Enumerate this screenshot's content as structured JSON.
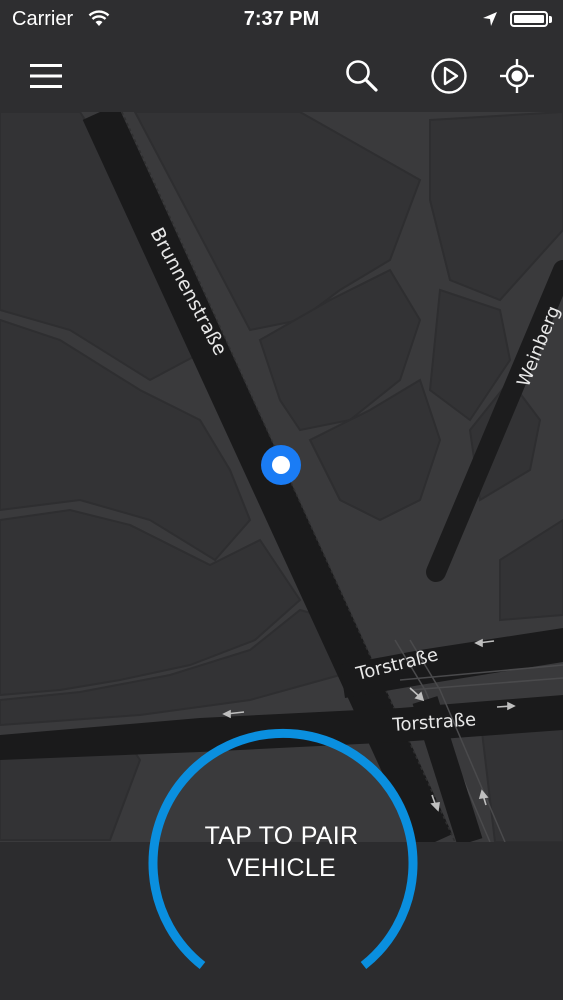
{
  "status_bar": {
    "carrier": "Carrier",
    "time": "7:37 PM"
  },
  "nav": {
    "icons": [
      "menu-icon",
      "search-icon",
      "play-icon",
      "crosshair-icon"
    ]
  },
  "map": {
    "street_labels": {
      "brunnen": "Brunnenstraße",
      "weinberg": "Weinberg",
      "tor_upper": "Torstraße",
      "tor_lower": "Torstraße"
    }
  },
  "pair": {
    "line1": "TAP TO PAIR",
    "line2": "VEHICLE"
  },
  "colors": {
    "accent": "#0a8fdf",
    "location_dot": "#1a7cf5",
    "map_bg": "#3a3a3c",
    "bar_bg": "#2e2e30"
  }
}
